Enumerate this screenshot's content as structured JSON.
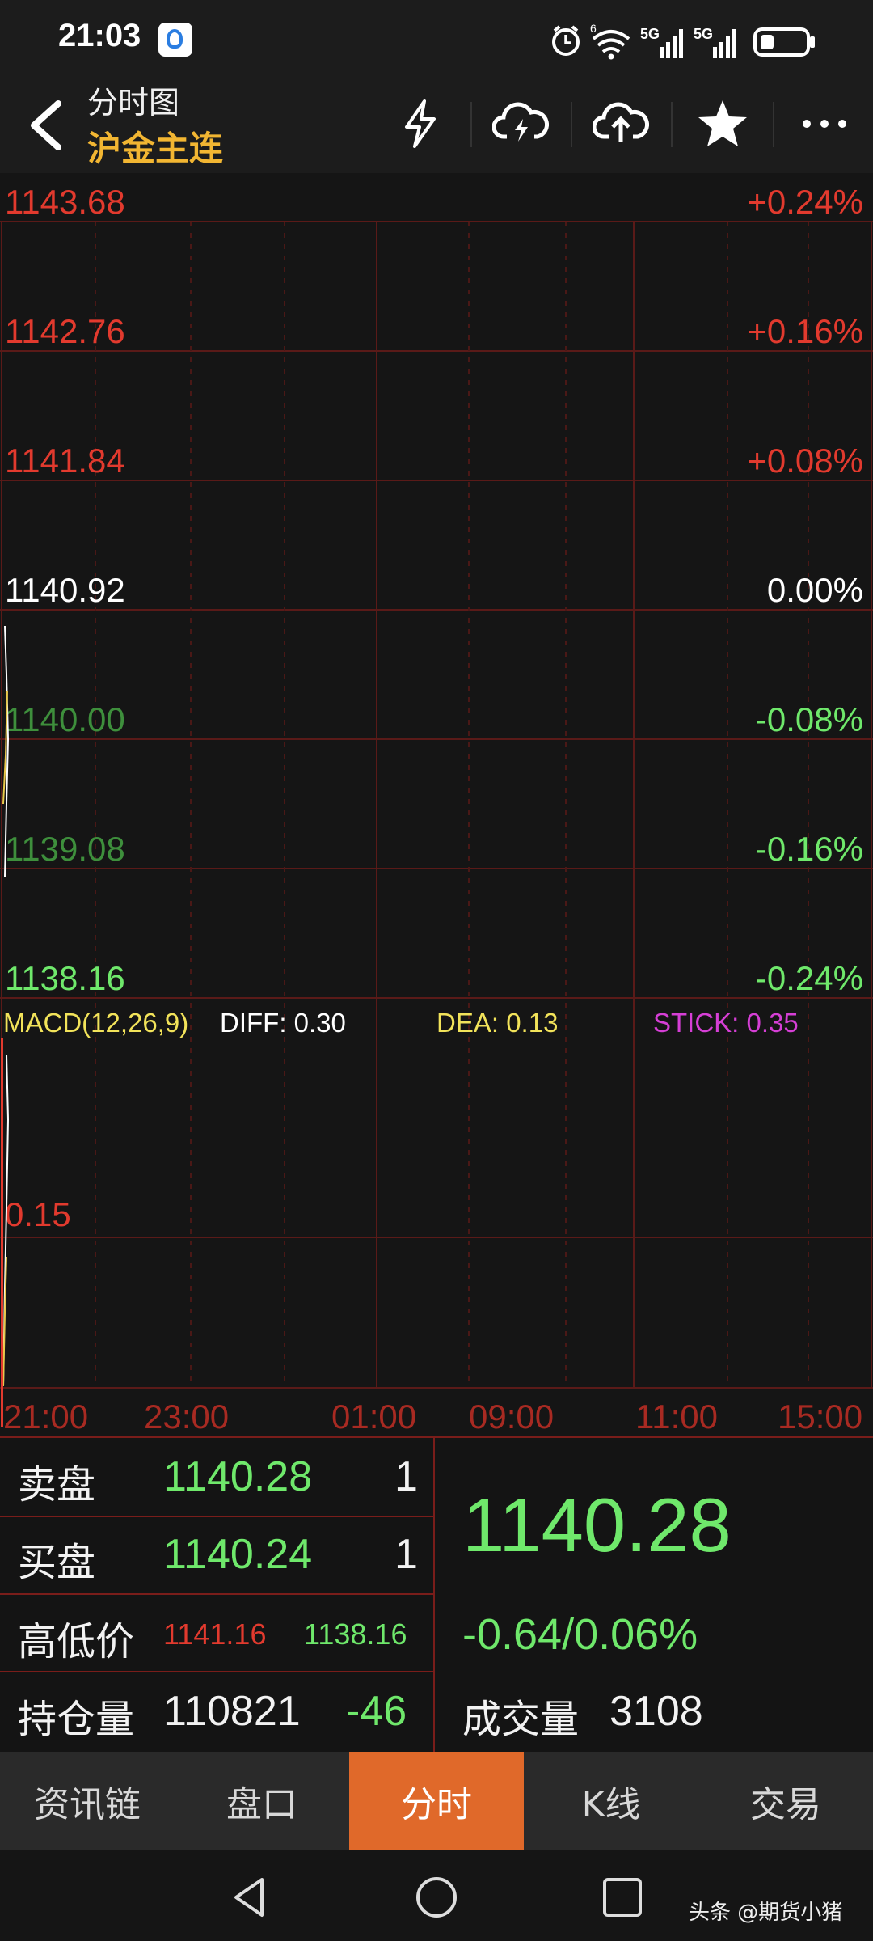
{
  "status": {
    "time": "21:03",
    "wifi_badge": "6",
    "net1": "5G",
    "net2": "5G"
  },
  "header": {
    "title": "分时图",
    "subtitle": "沪金主连",
    "accent": "#f2b632"
  },
  "price_axis": {
    "left": [
      "1143.68",
      "1142.76",
      "1141.84",
      "1140.92",
      "1140.00",
      "1139.08",
      "1138.16"
    ],
    "right": [
      "+0.24%",
      "+0.16%",
      "+0.08%",
      "0.00%",
      "-0.08%",
      "-0.16%",
      "-0.24%"
    ],
    "up_color": "#e23a2e",
    "down_color": "#6fe86b"
  },
  "macd": {
    "label": "MACD(12,26,9)",
    "diff": "DIFF: 0.30",
    "dea": "DEA: 0.13",
    "stick": "STICK: 0.35",
    "level": "0.15"
  },
  "time_axis": [
    "21:00",
    "23:00",
    "01:00",
    "09:00",
    "11:00",
    "15:00"
  ],
  "info": {
    "ask_label": "卖盘",
    "ask_price": "1140.28",
    "ask_vol": "1",
    "bid_label": "买盘",
    "bid_price": "1140.24",
    "bid_vol": "1",
    "hl_label": "高低价",
    "high": "1141.16",
    "low": "1138.16",
    "oi_label": "持仓量",
    "oi": "110821",
    "oi_change": "-46",
    "last": "1140.28",
    "change": "-0.64/0.06%",
    "volume_label": "成交量",
    "volume": "3108"
  },
  "tabs": [
    {
      "label": "资讯链",
      "active": false
    },
    {
      "label": "盘口",
      "active": false
    },
    {
      "label": "分时",
      "active": true
    },
    {
      "label": "K线",
      "active": false
    },
    {
      "label": "交易",
      "active": false
    }
  ],
  "watermark": "头条 @期货小猪"
}
